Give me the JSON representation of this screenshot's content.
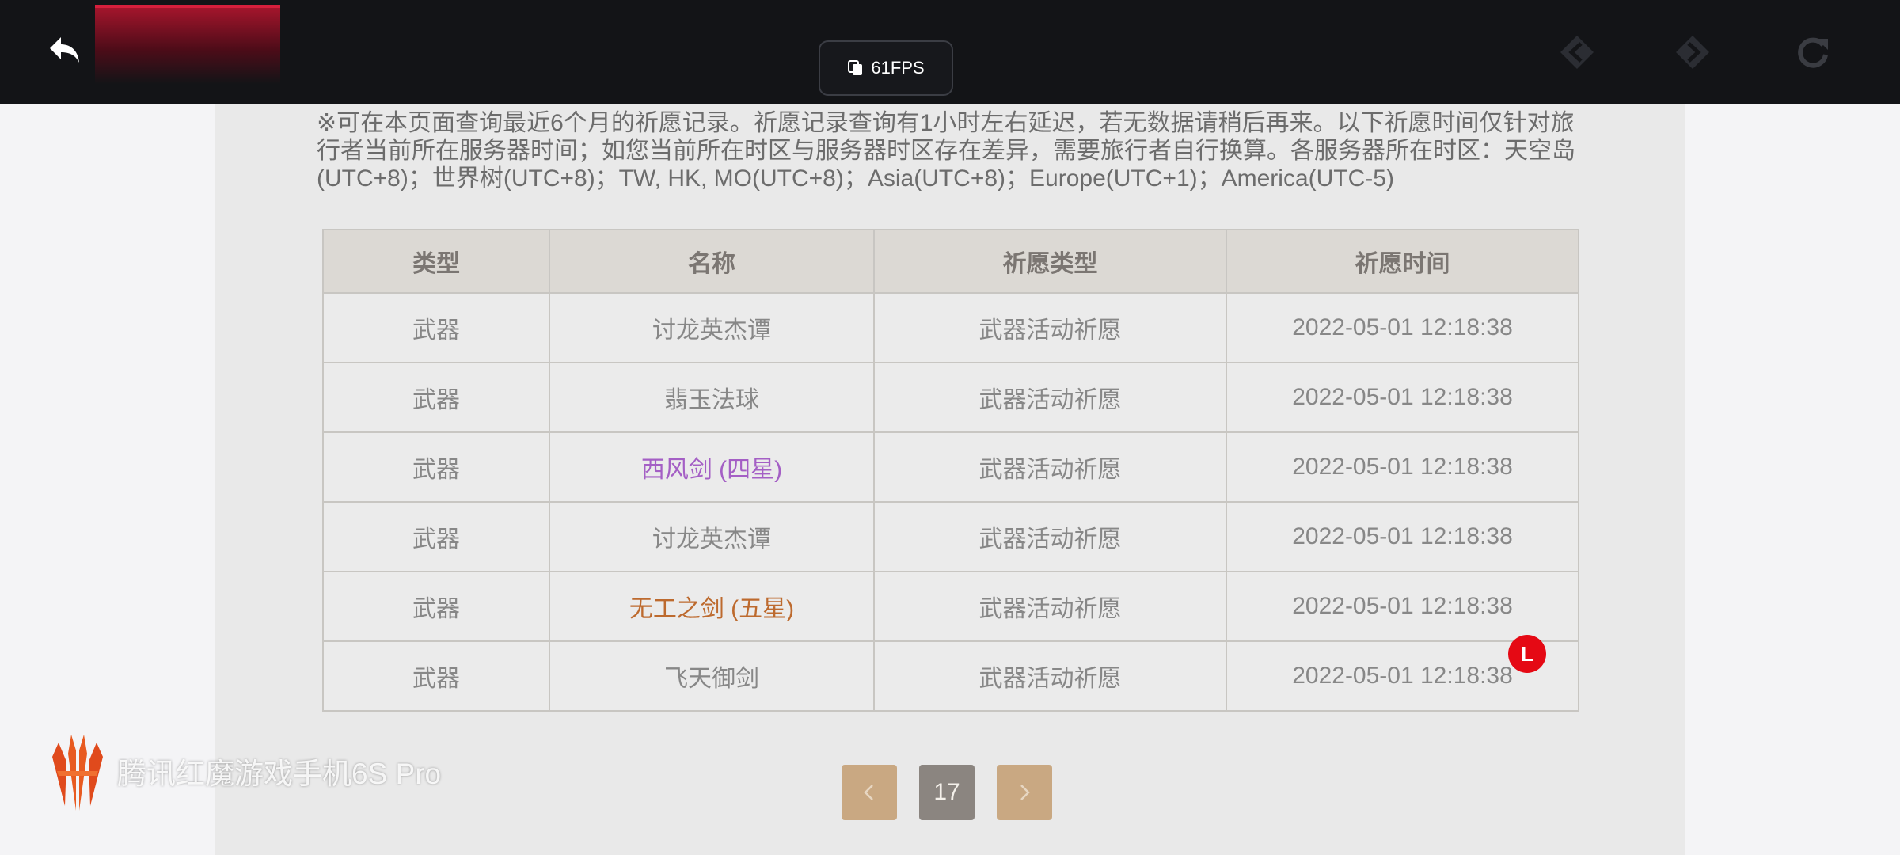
{
  "overlay": {
    "fps": "61FPS",
    "badge": "L",
    "watermark": "腾讯红魔游戏手机6S Pro"
  },
  "notice": "※可在本页面查询最近6个月的祈愿记录。祈愿记录查询有1小时左右延迟，若无数据请稍后再来。以下祈愿时间仅针对旅行者当前所在服务器时间；如您当前所在时区与服务器时区存在差异，需要旅行者自行换算。各服务器所在时区：天空岛(UTC+8)；世界树(UTC+8)；TW, HK, MO(UTC+8)；Asia(UTC+8)；Europe(UTC+1)；America(UTC-5)",
  "table": {
    "headers": [
      "类型",
      "名称",
      "祈愿类型",
      "祈愿时间"
    ],
    "rows": [
      {
        "type": "武器",
        "name": "讨龙英杰谭",
        "banner": "武器活动祈愿",
        "time": "2022-05-01 12:18:38"
      },
      {
        "type": "武器",
        "name": "翡玉法球",
        "banner": "武器活动祈愿",
        "time": "2022-05-01 12:18:38"
      },
      {
        "type": "武器",
        "name": "西风剑 (四星)",
        "banner": "武器活动祈愿",
        "time": "2022-05-01 12:18:38"
      },
      {
        "type": "武器",
        "name": "讨龙英杰谭",
        "banner": "武器活动祈愿",
        "time": "2022-05-01 12:18:38"
      },
      {
        "type": "武器",
        "name": "无工之剑 (五星)",
        "banner": "武器活动祈愿",
        "time": "2022-05-01 12:18:38"
      },
      {
        "type": "武器",
        "name": "飞天御剑",
        "banner": "武器活动祈愿",
        "time": "2022-05-01 12:18:38"
      }
    ]
  },
  "pagination": {
    "current": "17"
  },
  "colors": {
    "four_star": "#a45fc5",
    "five_star": "#bd6a2e",
    "pager_arrow": "#c9a882",
    "pager_current": "#8b8580"
  }
}
